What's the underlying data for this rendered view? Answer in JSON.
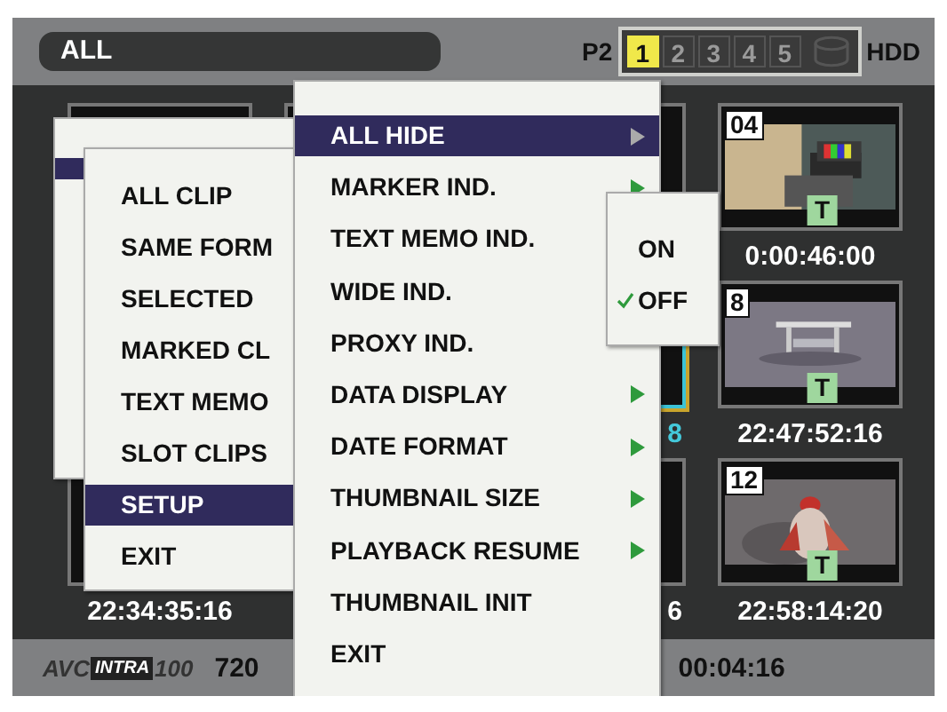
{
  "header": {
    "filter": "ALL",
    "media": "P2",
    "slots": [
      {
        "label": "1",
        "active": true
      },
      {
        "label": "2",
        "active": false
      },
      {
        "label": "3",
        "active": false
      },
      {
        "label": "4",
        "active": false
      },
      {
        "label": "5",
        "active": false
      }
    ],
    "drive": "HDD"
  },
  "thumbnails": [
    {
      "kind": "frame"
    },
    {
      "kind": "frame"
    },
    {
      "kind": "edge"
    },
    {
      "kind": "picture",
      "number": "04",
      "memo": "T",
      "timecode": "0:00:46:00"
    },
    {
      "kind": "covered"
    },
    {
      "kind": "covered"
    },
    {
      "kind": "edge",
      "selected": true,
      "timecode": "8"
    },
    {
      "kind": "picture",
      "number": "8",
      "memo": "T",
      "timecode": "22:47:52:16"
    },
    {
      "kind": "frame",
      "timecode": "22:34:35:16"
    },
    {
      "kind": "covered"
    },
    {
      "kind": "edge",
      "timecode": "6"
    },
    {
      "kind": "picture",
      "number": "12",
      "memo": "T",
      "timecode": "22:58:14:20"
    }
  ],
  "status_bar": {
    "codec": [
      "AVC",
      "INTRA",
      "100"
    ],
    "format": "720",
    "duration": "00:04:16"
  },
  "main_menu": [
    {
      "label": "ALL CLIP",
      "selected": false
    },
    {
      "label": "SAME FORM",
      "selected": false
    },
    {
      "label": "SELECTED",
      "selected": false
    },
    {
      "label": "MARKED CL",
      "selected": false
    },
    {
      "label": "TEXT MEMO",
      "selected": false
    },
    {
      "label": "SLOT CLIPS",
      "selected": false
    },
    {
      "label": "SETUP",
      "selected": true
    },
    {
      "label": "EXIT",
      "selected": false
    }
  ],
  "setup_menu": [
    {
      "label": "ALL HIDE",
      "selected": true,
      "submenu": true
    },
    {
      "label": "MARKER IND.",
      "selected": false,
      "submenu": true
    },
    {
      "label": "TEXT MEMO IND.",
      "selected": false
    },
    {
      "label": "WIDE IND.",
      "selected": false
    },
    {
      "label": "PROXY IND.",
      "selected": false,
      "submenu": false
    },
    {
      "label": "DATA DISPLAY",
      "selected": false,
      "submenu": true
    },
    {
      "label": "DATE FORMAT",
      "selected": false,
      "submenu": true
    },
    {
      "label": "THUMBNAIL SIZE",
      "selected": false,
      "submenu": true
    },
    {
      "label": "PLAYBACK RESUME",
      "selected": false,
      "submenu": true
    },
    {
      "label": "THUMBNAIL INIT",
      "selected": false,
      "submenu": false
    },
    {
      "label": "EXIT",
      "selected": false,
      "submenu": false
    }
  ],
  "option_menu": [
    {
      "label": "ON",
      "checked": false
    },
    {
      "label": "OFF",
      "checked": true
    }
  ]
}
